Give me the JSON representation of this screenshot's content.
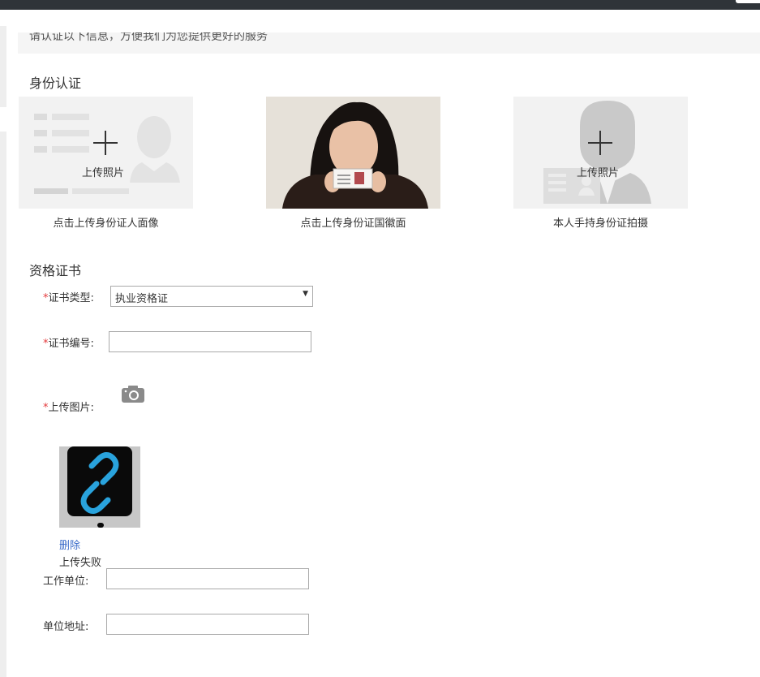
{
  "notice": {
    "text": "请认证以下信息，方便我们为您提供更好的服务"
  },
  "identity": {
    "title": "身份认证",
    "cards": [
      {
        "upload_label": "上传照片",
        "caption": "点击上传身份证人面像"
      },
      {
        "upload_label": "",
        "caption": "点击上传身份证国徽面"
      },
      {
        "upload_label": "上传照片",
        "caption": "本人手持身份证拍摄"
      }
    ]
  },
  "certificate": {
    "title": "资格证书",
    "required_mark": "*",
    "type_label": "证书类型:",
    "type_value": "执业资格证",
    "type_arrow": "▼",
    "number_label": "证书编号:",
    "number_value": "",
    "image_label": "上传图片:",
    "delete_label": "删除",
    "upload_status": "上传失败"
  },
  "work": {
    "unit_label": "工作单位:",
    "unit_value": "",
    "address_label": "单位地址:",
    "address_value": ""
  },
  "colors": {
    "top_bar": "#2f3439",
    "required": "#e4393c",
    "link": "#3a6bc9",
    "broken_link_icon": "#29a3dd"
  },
  "icons": {
    "camera": "camera-icon",
    "plus": "plus-icon",
    "broken_image": "broken-link-icon"
  }
}
